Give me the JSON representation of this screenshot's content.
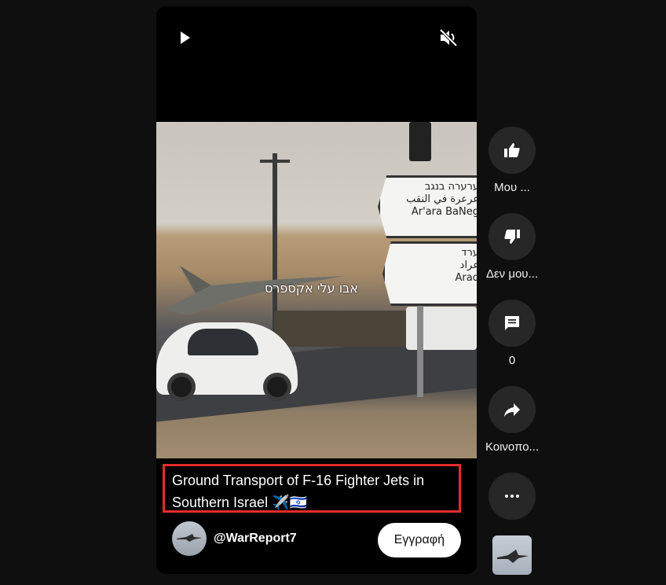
{
  "player": {
    "play_icon": "play-icon",
    "mute_icon": "muted-speaker-icon",
    "video_overlay_text": "אבו עלי אקספרס",
    "signs": {
      "top": [
        "ערערה בנגב",
        "عرعرة في النقب",
        "Ar'ara BaNeg"
      ],
      "bottom": [
        "ערד",
        "عراد",
        "Arad"
      ]
    }
  },
  "video": {
    "title": "Ground Transport of F-16 Fighter Jets in Southern Israel ✈️🇮🇱",
    "channel_handle": "@WarReport7",
    "subscribe_label": "Εγγραφή"
  },
  "actions": {
    "like": {
      "label": "Μου ...",
      "icon": "thumbs-up-icon"
    },
    "dislike": {
      "label": "Δεν μου...",
      "icon": "thumbs-down-icon"
    },
    "comments": {
      "label": "0",
      "icon": "comment-icon"
    },
    "share": {
      "label": "Κοινοπο...",
      "icon": "share-icon"
    },
    "more": {
      "icon": "more-horizontal-icon"
    }
  },
  "colors": {
    "background": "#0f0f0f",
    "highlight_border": "#e32b2b",
    "action_button": "#272727"
  }
}
